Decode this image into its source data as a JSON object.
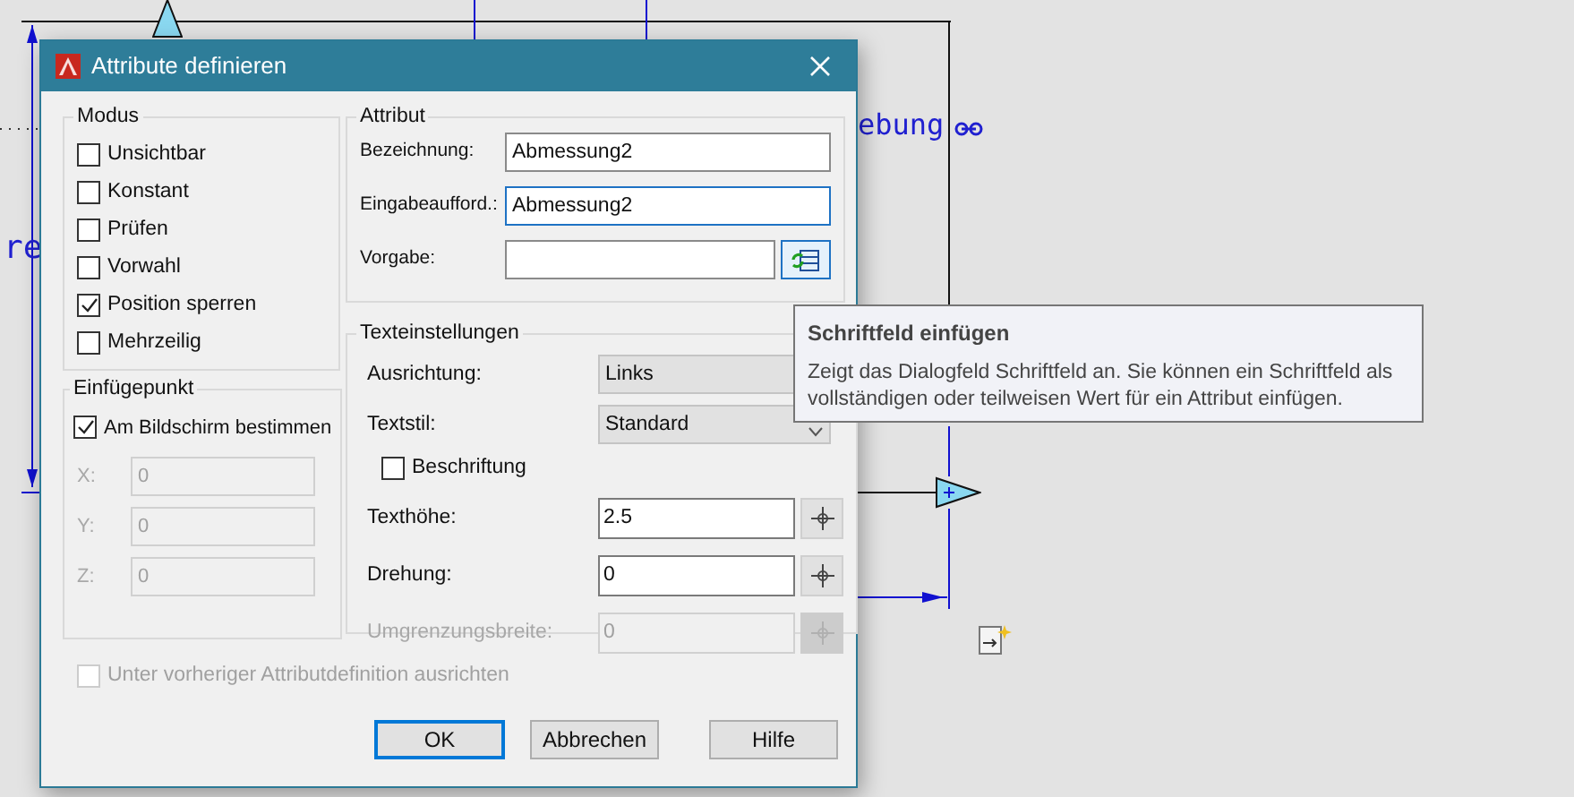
{
  "canvas": {
    "labels": [
      {
        "text": "re"
      },
      {
        "text": "ebung"
      }
    ]
  },
  "dialog": {
    "title": "Attribute definieren",
    "modus": {
      "label": "Modus",
      "options": [
        {
          "label": "Unsichtbar",
          "checked": false
        },
        {
          "label": "Konstant",
          "checked": false
        },
        {
          "label": "Prüfen",
          "checked": false
        },
        {
          "label": "Vorwahl",
          "checked": false
        },
        {
          "label": "Position sperren",
          "checked": true
        },
        {
          "label": "Mehrzeilig",
          "checked": false
        }
      ]
    },
    "insertion": {
      "label": "Einfügepunkt",
      "on_screen": {
        "label": "Am Bildschirm bestimmen",
        "checked": true
      },
      "coords": [
        {
          "label": "X:",
          "value": "0",
          "disabled": true
        },
        {
          "label": "Y:",
          "value": "0",
          "disabled": true
        },
        {
          "label": "Z:",
          "value": "0",
          "disabled": true
        }
      ]
    },
    "attribute": {
      "label": "Attribut",
      "fields": [
        {
          "label": "Bezeichnung:",
          "value": "Abmessung2",
          "focused": false
        },
        {
          "label": "Eingabeaufford.:",
          "value": "Abmessung2",
          "focused": true
        },
        {
          "label": "Vorgabe:",
          "focused": false,
          "field_button": true
        }
      ]
    },
    "text_settings": {
      "label": "Texteinstellungen",
      "rows": [
        {
          "kind": "select",
          "label": "Ausrichtung:",
          "value": "Links"
        },
        {
          "kind": "select",
          "label": "Textstil:",
          "value": "Standard",
          "chevron": true
        },
        {
          "kind": "checkbox",
          "label": "Beschriftung",
          "checked": false
        },
        {
          "kind": "input",
          "label": "Texthöhe:",
          "value": "2.5",
          "disabled": false
        },
        {
          "kind": "input",
          "label": "Drehung:",
          "value": "0",
          "disabled": false
        },
        {
          "kind": "input",
          "label": "Umgrenzungsbreite:",
          "value": "0",
          "disabled": true
        }
      ]
    },
    "align_below": {
      "label": "Unter vorheriger Attributdefinition ausrichten",
      "checked": false,
      "disabled": true
    },
    "buttons": [
      {
        "label": "OK",
        "default": true
      },
      {
        "label": "Abbrechen",
        "default": false
      },
      {
        "label": "Hilfe",
        "default": false
      }
    ]
  },
  "tooltip": {
    "title": "Schriftfeld einfügen",
    "text": "Zeigt das Dialogfeld Schriftfeld an. Sie können ein Schriftfeld als vollständigen oder teilweisen Wert für ein Attribut einfügen."
  }
}
